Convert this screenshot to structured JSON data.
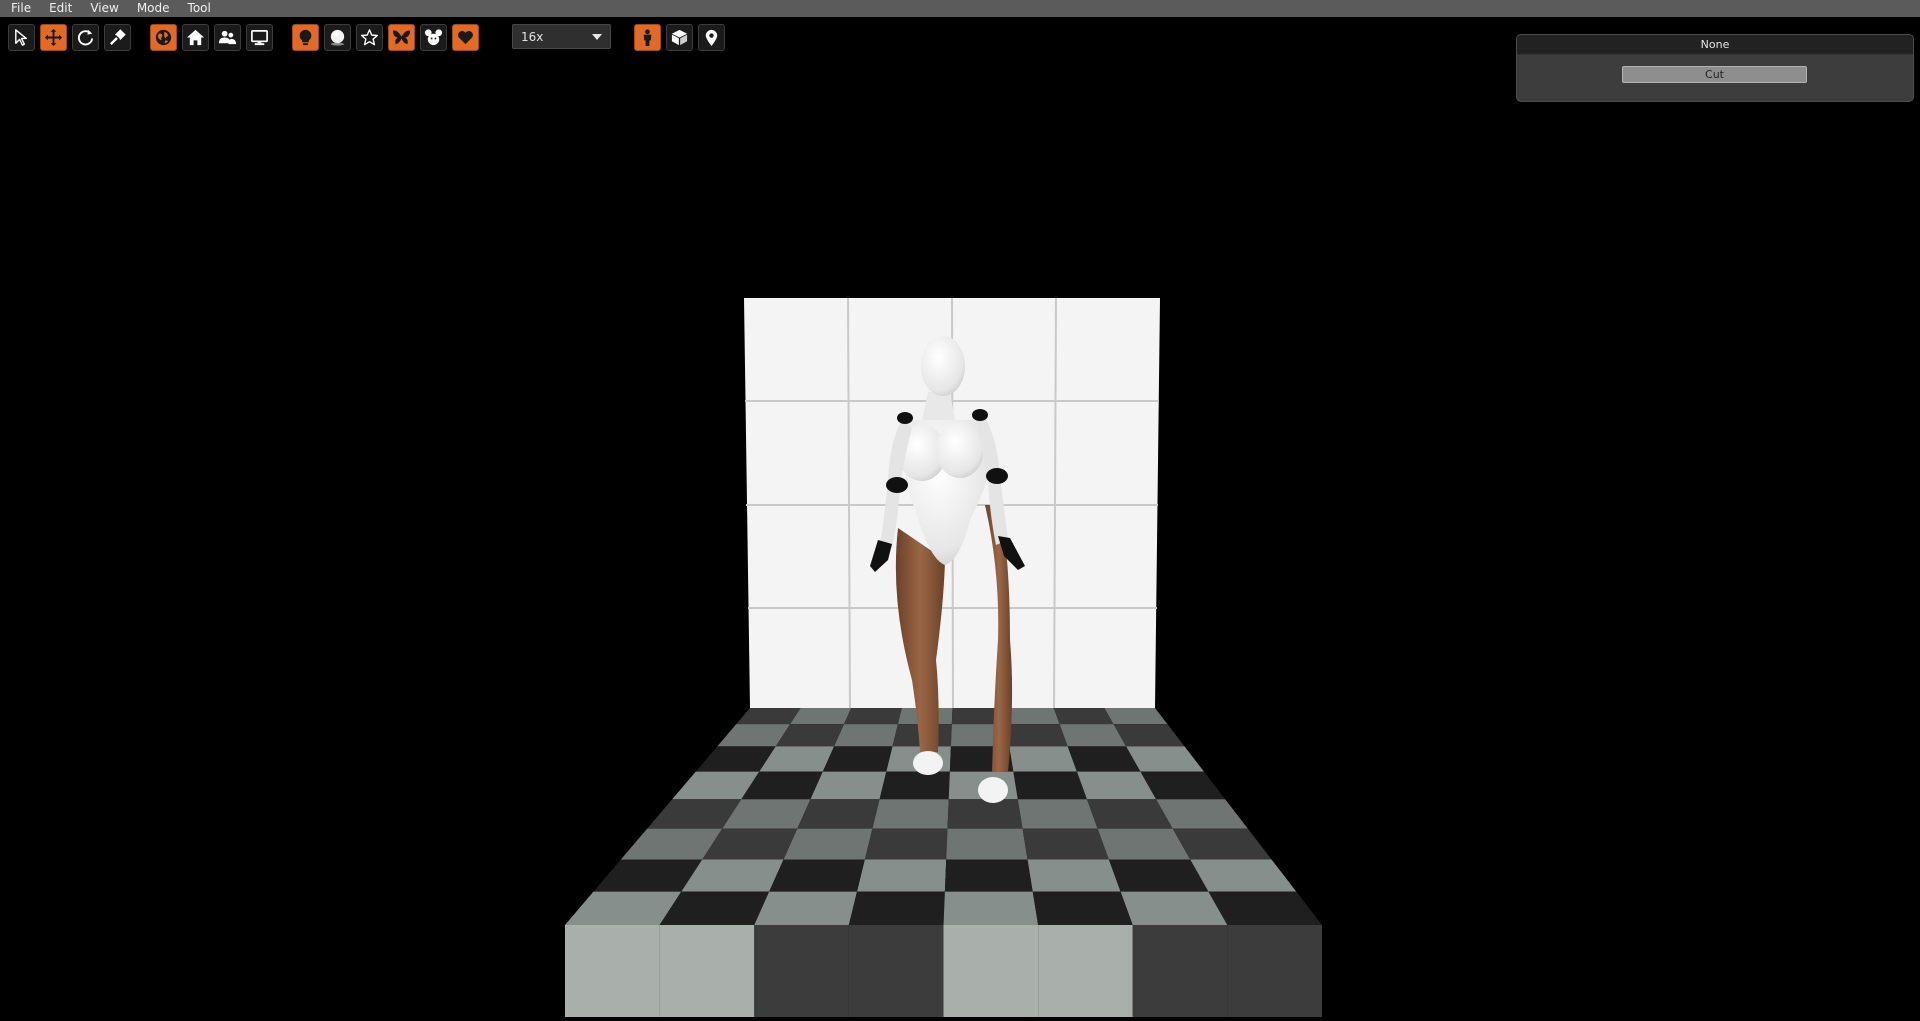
{
  "menu": [
    "File",
    "Edit",
    "View",
    "Mode",
    "Tool"
  ],
  "toolbar": {
    "transform_tools": [
      {
        "name": "select-pointer-icon",
        "active": false
      },
      {
        "name": "move-arrows-icon",
        "active": true
      },
      {
        "name": "rotate-icon",
        "active": false
      },
      {
        "name": "scale-tool-icon",
        "active": false
      }
    ],
    "view_tools": [
      {
        "name": "globe-icon",
        "active": true
      },
      {
        "name": "home-icon",
        "active": false
      },
      {
        "name": "users-icon",
        "active": false
      },
      {
        "name": "monitor-icon",
        "active": false
      }
    ],
    "scene_tools": [
      {
        "name": "lightbulb-icon",
        "active": true
      },
      {
        "name": "sphere-icon",
        "active": false
      },
      {
        "name": "star-icon",
        "active": false
      },
      {
        "name": "butterfly-icon",
        "active": true
      },
      {
        "name": "mickey-icon",
        "active": false
      },
      {
        "name": "heart-icon",
        "active": true
      }
    ],
    "zoom_select": "16x",
    "object_tools": [
      {
        "name": "person-icon",
        "active": true
      },
      {
        "name": "box-icon",
        "active": false
      },
      {
        "name": "map-pin-icon",
        "active": false
      }
    ]
  },
  "panel": {
    "title": "None",
    "cut_label": "Cut"
  },
  "colors": {
    "accent": "#e06a26",
    "menubar": "#5b5b5b",
    "panel_bg": "#3d3d3d"
  }
}
